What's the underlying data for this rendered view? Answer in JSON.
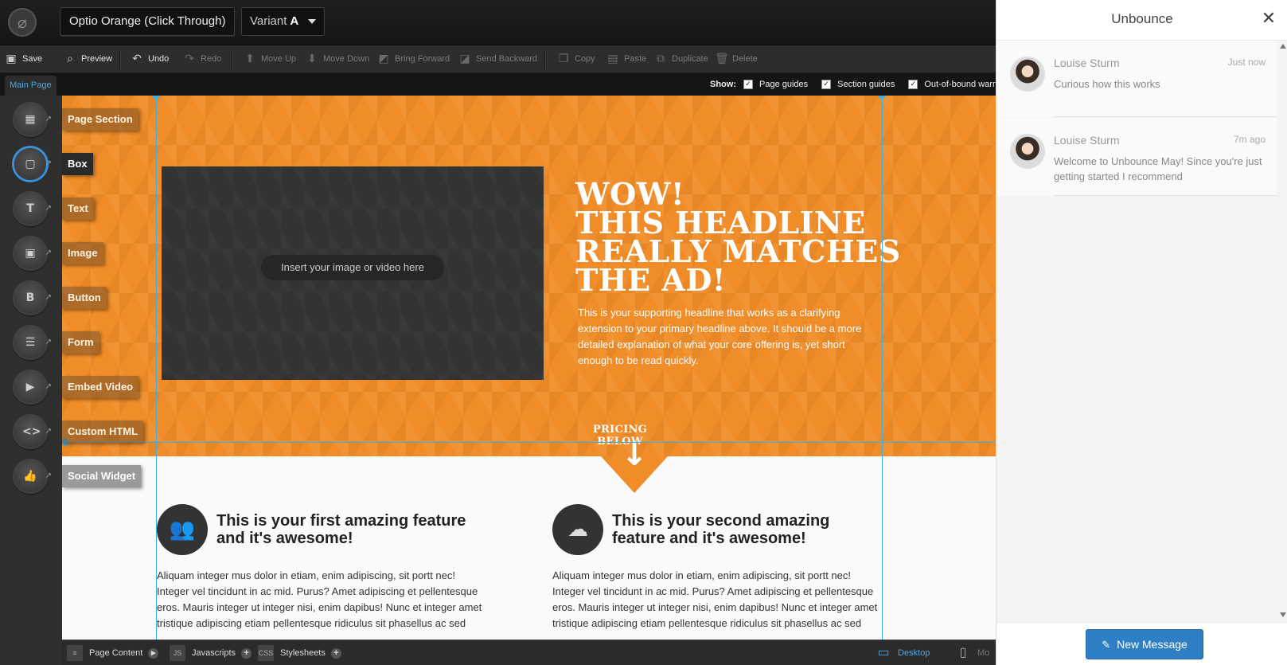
{
  "topbar": {
    "logo_glyph": "⌀",
    "page_name": "Optio Orange (Click Through)",
    "variant_label": "Variant",
    "variant_value": "A"
  },
  "toolbar": {
    "save": "Save",
    "preview": "Preview",
    "undo": "Undo",
    "redo": "Redo",
    "move_up": "Move Up",
    "move_down": "Move Down",
    "bring_forward": "Bring Forward",
    "send_backward": "Send Backward",
    "copy": "Copy",
    "paste": "Paste",
    "duplicate": "Duplicate",
    "delete": "Delete"
  },
  "tabs": {
    "main_page": "Main Page",
    "show_label": "Show:",
    "options": [
      "Page guides",
      "Section guides",
      "Out-of-bound warni"
    ]
  },
  "tools": [
    {
      "label": "Page Section",
      "icon": "page-section-icon",
      "glyph": "▦"
    },
    {
      "label": "Box",
      "icon": "box-icon",
      "glyph": "▢"
    },
    {
      "label": "Text",
      "icon": "text-icon",
      "glyph": "T"
    },
    {
      "label": "Image",
      "icon": "image-icon",
      "glyph": "▣"
    },
    {
      "label": "Button",
      "icon": "button-icon",
      "glyph": "B"
    },
    {
      "label": "Form",
      "icon": "form-icon",
      "glyph": "☰"
    },
    {
      "label": "Embed Video",
      "icon": "video-icon",
      "glyph": "▶"
    },
    {
      "label": "Custom HTML",
      "icon": "code-icon",
      "glyph": "<>"
    },
    {
      "label": "Social Widget",
      "icon": "thumbs-up-icon",
      "glyph": "👍"
    }
  ],
  "canvas": {
    "media_placeholder": "Insert your image or video here",
    "headline": [
      "WOW!",
      "THIS HEADLINE",
      "REALLY MATCHES",
      "THE AD!"
    ],
    "subheadline": "This is your supporting headline that works as a clarifying extension to your primary headline above. It should be a more detailed explanation of what your core offering is, yet short enough to be read quickly.",
    "pricing_label": "PRICING BELOW",
    "features": [
      {
        "title": "This is your first amazing feature and it's awesome!",
        "body": "Aliquam integer mus dolor in etiam, enim adipiscing, sit portt nec! Integer vel tincidunt in ac mid. Purus? Amet adipiscing et pellentesque eros. Mauris integer ut integer nisi, enim dapibus! Nunc et integer amet tristique adipiscing etiam pellentesque ridiculus sit phasellus ac sed"
      },
      {
        "title": "This is your second amazing feature and it's awesome!",
        "body": "Aliquam integer mus dolor in etiam, enim adipiscing, sit portt nec! Integer vel tincidunt in ac mid. Purus? Amet adipiscing et pellentesque eros. Mauris integer ut integer nisi, enim dapibus! Nunc et integer amet tristique adipiscing etiam pellentesque ridiculus sit phasellus ac sed"
      }
    ],
    "colors": {
      "hero": "#f08d28",
      "guide": "#3aaee8"
    }
  },
  "bottombar": {
    "page_content": "Page Content",
    "javascripts": "Javascripts",
    "js_badge": "JS",
    "stylesheets": "Stylesheets",
    "css_badge": "CSS",
    "desktop": "Desktop",
    "mobile": "Mo"
  },
  "chat": {
    "title": "Unbounce",
    "messages": [
      {
        "author": "Louise Sturm",
        "time": "Just now",
        "text": "Curious how this works"
      },
      {
        "author": "Louise Sturm",
        "time": "7m ago",
        "text": "Welcome to Unbounce May! Since you're just getting started I recommend"
      }
    ],
    "new_message": "New Message"
  }
}
